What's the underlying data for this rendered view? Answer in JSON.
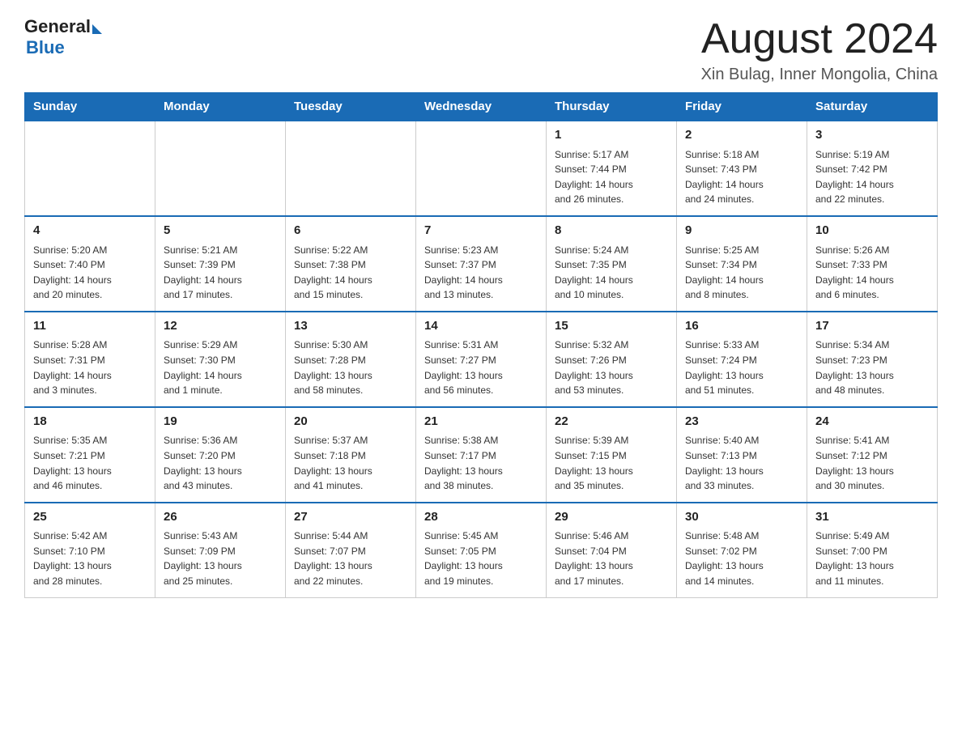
{
  "header": {
    "logo_general": "General",
    "logo_blue": "Blue",
    "month_title": "August 2024",
    "location": "Xin Bulag, Inner Mongolia, China"
  },
  "weekdays": [
    "Sunday",
    "Monday",
    "Tuesday",
    "Wednesday",
    "Thursday",
    "Friday",
    "Saturday"
  ],
  "weeks": [
    [
      {
        "day": "",
        "info": ""
      },
      {
        "day": "",
        "info": ""
      },
      {
        "day": "",
        "info": ""
      },
      {
        "day": "",
        "info": ""
      },
      {
        "day": "1",
        "info": "Sunrise: 5:17 AM\nSunset: 7:44 PM\nDaylight: 14 hours\nand 26 minutes."
      },
      {
        "day": "2",
        "info": "Sunrise: 5:18 AM\nSunset: 7:43 PM\nDaylight: 14 hours\nand 24 minutes."
      },
      {
        "day": "3",
        "info": "Sunrise: 5:19 AM\nSunset: 7:42 PM\nDaylight: 14 hours\nand 22 minutes."
      }
    ],
    [
      {
        "day": "4",
        "info": "Sunrise: 5:20 AM\nSunset: 7:40 PM\nDaylight: 14 hours\nand 20 minutes."
      },
      {
        "day": "5",
        "info": "Sunrise: 5:21 AM\nSunset: 7:39 PM\nDaylight: 14 hours\nand 17 minutes."
      },
      {
        "day": "6",
        "info": "Sunrise: 5:22 AM\nSunset: 7:38 PM\nDaylight: 14 hours\nand 15 minutes."
      },
      {
        "day": "7",
        "info": "Sunrise: 5:23 AM\nSunset: 7:37 PM\nDaylight: 14 hours\nand 13 minutes."
      },
      {
        "day": "8",
        "info": "Sunrise: 5:24 AM\nSunset: 7:35 PM\nDaylight: 14 hours\nand 10 minutes."
      },
      {
        "day": "9",
        "info": "Sunrise: 5:25 AM\nSunset: 7:34 PM\nDaylight: 14 hours\nand 8 minutes."
      },
      {
        "day": "10",
        "info": "Sunrise: 5:26 AM\nSunset: 7:33 PM\nDaylight: 14 hours\nand 6 minutes."
      }
    ],
    [
      {
        "day": "11",
        "info": "Sunrise: 5:28 AM\nSunset: 7:31 PM\nDaylight: 14 hours\nand 3 minutes."
      },
      {
        "day": "12",
        "info": "Sunrise: 5:29 AM\nSunset: 7:30 PM\nDaylight: 14 hours\nand 1 minute."
      },
      {
        "day": "13",
        "info": "Sunrise: 5:30 AM\nSunset: 7:28 PM\nDaylight: 13 hours\nand 58 minutes."
      },
      {
        "day": "14",
        "info": "Sunrise: 5:31 AM\nSunset: 7:27 PM\nDaylight: 13 hours\nand 56 minutes."
      },
      {
        "day": "15",
        "info": "Sunrise: 5:32 AM\nSunset: 7:26 PM\nDaylight: 13 hours\nand 53 minutes."
      },
      {
        "day": "16",
        "info": "Sunrise: 5:33 AM\nSunset: 7:24 PM\nDaylight: 13 hours\nand 51 minutes."
      },
      {
        "day": "17",
        "info": "Sunrise: 5:34 AM\nSunset: 7:23 PM\nDaylight: 13 hours\nand 48 minutes."
      }
    ],
    [
      {
        "day": "18",
        "info": "Sunrise: 5:35 AM\nSunset: 7:21 PM\nDaylight: 13 hours\nand 46 minutes."
      },
      {
        "day": "19",
        "info": "Sunrise: 5:36 AM\nSunset: 7:20 PM\nDaylight: 13 hours\nand 43 minutes."
      },
      {
        "day": "20",
        "info": "Sunrise: 5:37 AM\nSunset: 7:18 PM\nDaylight: 13 hours\nand 41 minutes."
      },
      {
        "day": "21",
        "info": "Sunrise: 5:38 AM\nSunset: 7:17 PM\nDaylight: 13 hours\nand 38 minutes."
      },
      {
        "day": "22",
        "info": "Sunrise: 5:39 AM\nSunset: 7:15 PM\nDaylight: 13 hours\nand 35 minutes."
      },
      {
        "day": "23",
        "info": "Sunrise: 5:40 AM\nSunset: 7:13 PM\nDaylight: 13 hours\nand 33 minutes."
      },
      {
        "day": "24",
        "info": "Sunrise: 5:41 AM\nSunset: 7:12 PM\nDaylight: 13 hours\nand 30 minutes."
      }
    ],
    [
      {
        "day": "25",
        "info": "Sunrise: 5:42 AM\nSunset: 7:10 PM\nDaylight: 13 hours\nand 28 minutes."
      },
      {
        "day": "26",
        "info": "Sunrise: 5:43 AM\nSunset: 7:09 PM\nDaylight: 13 hours\nand 25 minutes."
      },
      {
        "day": "27",
        "info": "Sunrise: 5:44 AM\nSunset: 7:07 PM\nDaylight: 13 hours\nand 22 minutes."
      },
      {
        "day": "28",
        "info": "Sunrise: 5:45 AM\nSunset: 7:05 PM\nDaylight: 13 hours\nand 19 minutes."
      },
      {
        "day": "29",
        "info": "Sunrise: 5:46 AM\nSunset: 7:04 PM\nDaylight: 13 hours\nand 17 minutes."
      },
      {
        "day": "30",
        "info": "Sunrise: 5:48 AM\nSunset: 7:02 PM\nDaylight: 13 hours\nand 14 minutes."
      },
      {
        "day": "31",
        "info": "Sunrise: 5:49 AM\nSunset: 7:00 PM\nDaylight: 13 hours\nand 11 minutes."
      }
    ]
  ]
}
